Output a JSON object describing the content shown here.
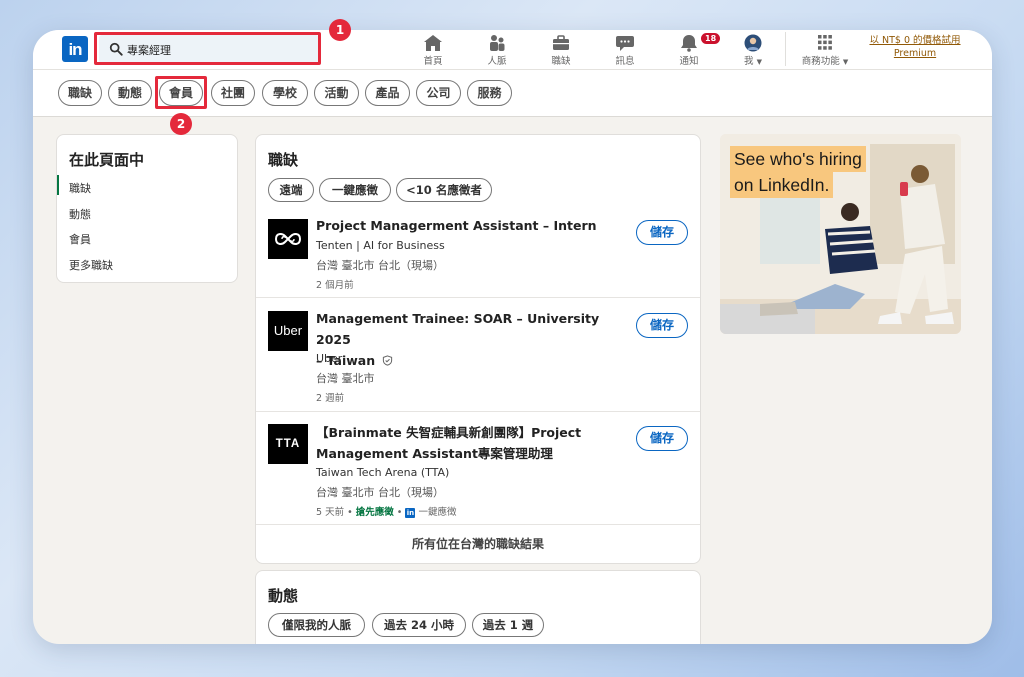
{
  "header": {
    "logo": "in",
    "search_value": "專案經理",
    "nav": [
      {
        "label": "首頁",
        "icon": "home-icon"
      },
      {
        "label": "人脈",
        "icon": "people-icon"
      },
      {
        "label": "職缺",
        "icon": "briefcase-icon"
      },
      {
        "label": "訊息",
        "icon": "message-icon"
      },
      {
        "label": "通知",
        "icon": "bell-icon",
        "badge": "18"
      },
      {
        "label": "我",
        "icon": "avatar-icon"
      },
      {
        "label": "商務功能",
        "icon": "grid-icon"
      }
    ],
    "premium_line1": "以 NT$ 0 的價格試用",
    "premium_line2": "Premium"
  },
  "filters": [
    "職缺",
    "動態",
    "會員",
    "社團",
    "學校",
    "活動",
    "產品",
    "公司",
    "服務"
  ],
  "annotations": {
    "step1": "1",
    "step2": "2",
    "color": "#e4293b"
  },
  "sidebar": {
    "title": "在此頁面中",
    "items": [
      "職缺",
      "動態",
      "會員",
      "更多職缺"
    ]
  },
  "jobs_section": {
    "title": "職缺",
    "chips": [
      "遠端",
      "一鍵應徵",
      "<10 名應徵者"
    ],
    "jobs": [
      {
        "logo_text": "",
        "title_line1": "Project Managerment Assistant – Intern",
        "title_line2": "",
        "company": "Tenten | AI for Business",
        "location": "台灣 臺北市 台北（現場）",
        "time": "2 個月前",
        "extra": "",
        "save": "儲存"
      },
      {
        "logo_text": "Uber",
        "title_line1": "Management Trainee: SOAR – University 2025",
        "title_line2": "– Taiwan",
        "company": "Uber",
        "location": "台灣 臺北市",
        "time": "2 週前",
        "extra": "",
        "save": "儲存"
      },
      {
        "logo_text": "TTA",
        "title_line1": "【Brainmate 失智症輔具新創團隊】Project",
        "title_line2": "Management Assistant專案管理助理",
        "company": "Taiwan Tech Arena (TTA)",
        "location": "台灣 臺北市 台北（現場）",
        "time": "5 天前",
        "early": "搶先應徵",
        "easy_apply": "一鍵應徵",
        "save": "儲存"
      }
    ],
    "all_results": "所有位在台灣的職缺結果"
  },
  "posts_section": {
    "title": "動態",
    "chips": [
      "僅限我的人脈",
      "過去 24 小時",
      "過去 1 週"
    ]
  },
  "ad": {
    "line1": "See who's hiring",
    "line2": "on LinkedIn."
  }
}
